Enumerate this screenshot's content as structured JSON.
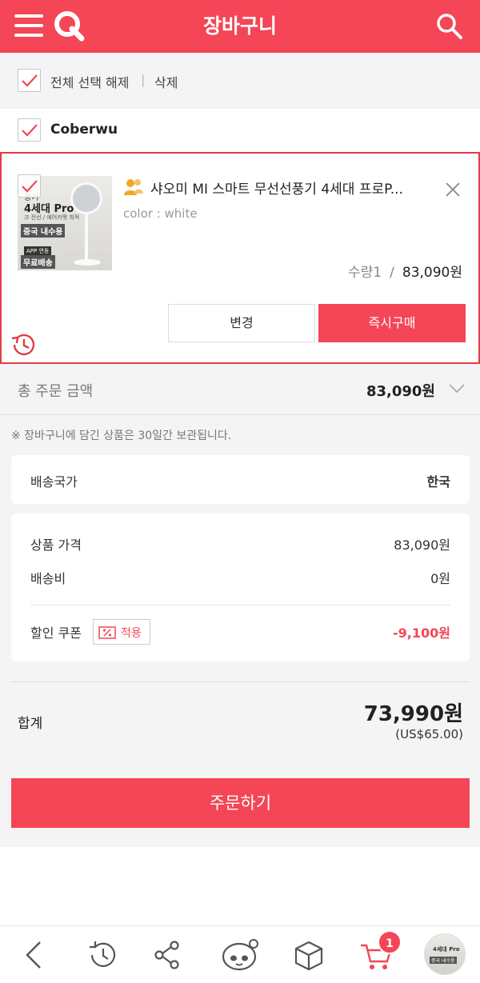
{
  "header": {
    "title": "장바구니"
  },
  "select_bar": {
    "toggle_all_label": "전체 선택 해제",
    "separator": "|",
    "delete_label": "삭제"
  },
  "seller": {
    "name": "Coberwu"
  },
  "product": {
    "title": "샤오미 MI 스마트 무선선풍기 4세대 프로P...",
    "option": "color : white",
    "qty_label": "수량1",
    "slash": "/",
    "price": "83,090원",
    "change_label": "변경",
    "buy_now_label": "즉시구매",
    "thumb_text": [
      "풍기",
      "4세대 Pro",
      "크 전선 / 에어카펫 최적",
      "중국 내수용",
      "APP 연동",
      "무료배송"
    ]
  },
  "total": {
    "label": "총 주문 금액",
    "value": "83,090원"
  },
  "notice": "※ 장바구니에 담긴 상품은 30일간 보관됩니다.",
  "shipping": {
    "label": "배송국가",
    "value": "한국"
  },
  "price_detail": {
    "item_price_label": "상품 가격",
    "item_price_value": "83,090원",
    "shipping_fee_label": "배송비",
    "shipping_fee_value": "0원",
    "coupon_label": "할인 쿠폰",
    "coupon_button": "적용",
    "coupon_value": "-9,100원"
  },
  "grand": {
    "label": "합계",
    "value": "73,990원",
    "usd": "(US$65.00)"
  },
  "order_button": "주문하기",
  "bottom_nav": {
    "cart_count": "1",
    "thumb_text": [
      "4세대 Pro",
      "중국 내수용"
    ]
  },
  "colors": {
    "accent": "#f44656",
    "border_highlight": "#e23b4a"
  }
}
